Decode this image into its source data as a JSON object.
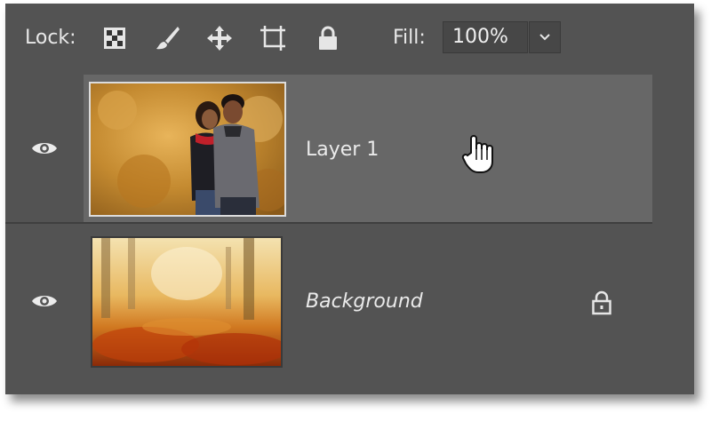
{
  "lock_bar": {
    "label": "Lock:",
    "icons": [
      "lock-transparent-pixels-icon",
      "lock-image-pixels-icon",
      "lock-position-icon",
      "prevent-auto-nesting-icon",
      "lock-all-icon"
    ]
  },
  "fill": {
    "label": "Fill:",
    "value": "100%"
  },
  "layers": [
    {
      "name": "Layer 1",
      "visible": true,
      "selected": true,
      "thumbnail": "couple-autumn-photo"
    },
    {
      "name": "Background",
      "visible": true,
      "selected": false,
      "locked": true,
      "thumbnail": "autumn-forest-photo"
    }
  ],
  "colors": {
    "panel": "#535353",
    "selected_row": "#676767",
    "text": "#eaeaea"
  }
}
